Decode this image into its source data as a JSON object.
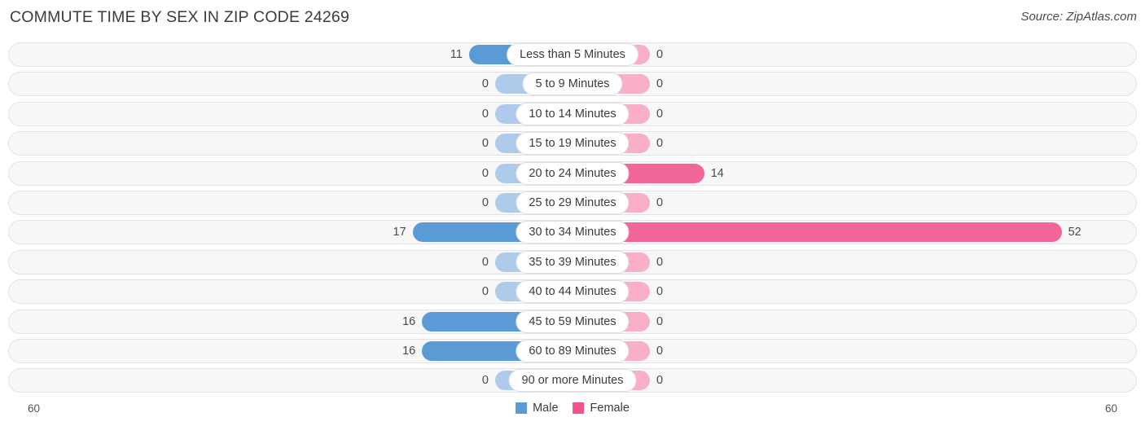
{
  "header": {
    "title": "COMMUTE TIME BY SEX IN ZIP CODE 24269",
    "source": "Source: ZipAtlas.com"
  },
  "legend": {
    "male_label": "Male",
    "female_label": "Female",
    "male_color": "#5b9bd5",
    "female_color": "#f0528c"
  },
  "axis": {
    "left_label": "60",
    "right_label": "60"
  },
  "chart_data": {
    "type": "bar",
    "title": "COMMUTE TIME BY SEX IN ZIP CODE 24269",
    "orientation": "horizontal-diverging",
    "xlabel": "",
    "ylabel": "",
    "xlim": [
      60,
      60
    ],
    "axis_max": 60,
    "grid": false,
    "legend_position": "bottom-center",
    "categories": [
      "Less than 5 Minutes",
      "5 to 9 Minutes",
      "10 to 14 Minutes",
      "15 to 19 Minutes",
      "20 to 24 Minutes",
      "25 to 29 Minutes",
      "30 to 34 Minutes",
      "35 to 39 Minutes",
      "40 to 44 Minutes",
      "45 to 59 Minutes",
      "60 to 89 Minutes",
      "90 or more Minutes"
    ],
    "series": [
      {
        "name": "Male",
        "color": "#5b9bd5",
        "values": [
          11,
          0,
          0,
          0,
          0,
          0,
          17,
          0,
          0,
          16,
          16,
          0
        ]
      },
      {
        "name": "Female",
        "color": "#f0528c",
        "values": [
          0,
          0,
          0,
          0,
          14,
          0,
          52,
          0,
          0,
          0,
          0,
          0
        ]
      }
    ]
  },
  "rows": [
    {
      "label": "Less than 5 Minutes",
      "male": "11",
      "female": "0"
    },
    {
      "label": "5 to 9 Minutes",
      "male": "0",
      "female": "0"
    },
    {
      "label": "10 to 14 Minutes",
      "male": "0",
      "female": "0"
    },
    {
      "label": "15 to 19 Minutes",
      "male": "0",
      "female": "0"
    },
    {
      "label": "20 to 24 Minutes",
      "male": "0",
      "female": "14"
    },
    {
      "label": "25 to 29 Minutes",
      "male": "0",
      "female": "0"
    },
    {
      "label": "30 to 34 Minutes",
      "male": "17",
      "female": "52"
    },
    {
      "label": "35 to 39 Minutes",
      "male": "0",
      "female": "0"
    },
    {
      "label": "40 to 44 Minutes",
      "male": "0",
      "female": "0"
    },
    {
      "label": "45 to 59 Minutes",
      "male": "16",
      "female": "0"
    },
    {
      "label": "60 to 89 Minutes",
      "male": "16",
      "female": "0"
    },
    {
      "label": "90 or more Minutes",
      "male": "0",
      "female": "0"
    }
  ]
}
